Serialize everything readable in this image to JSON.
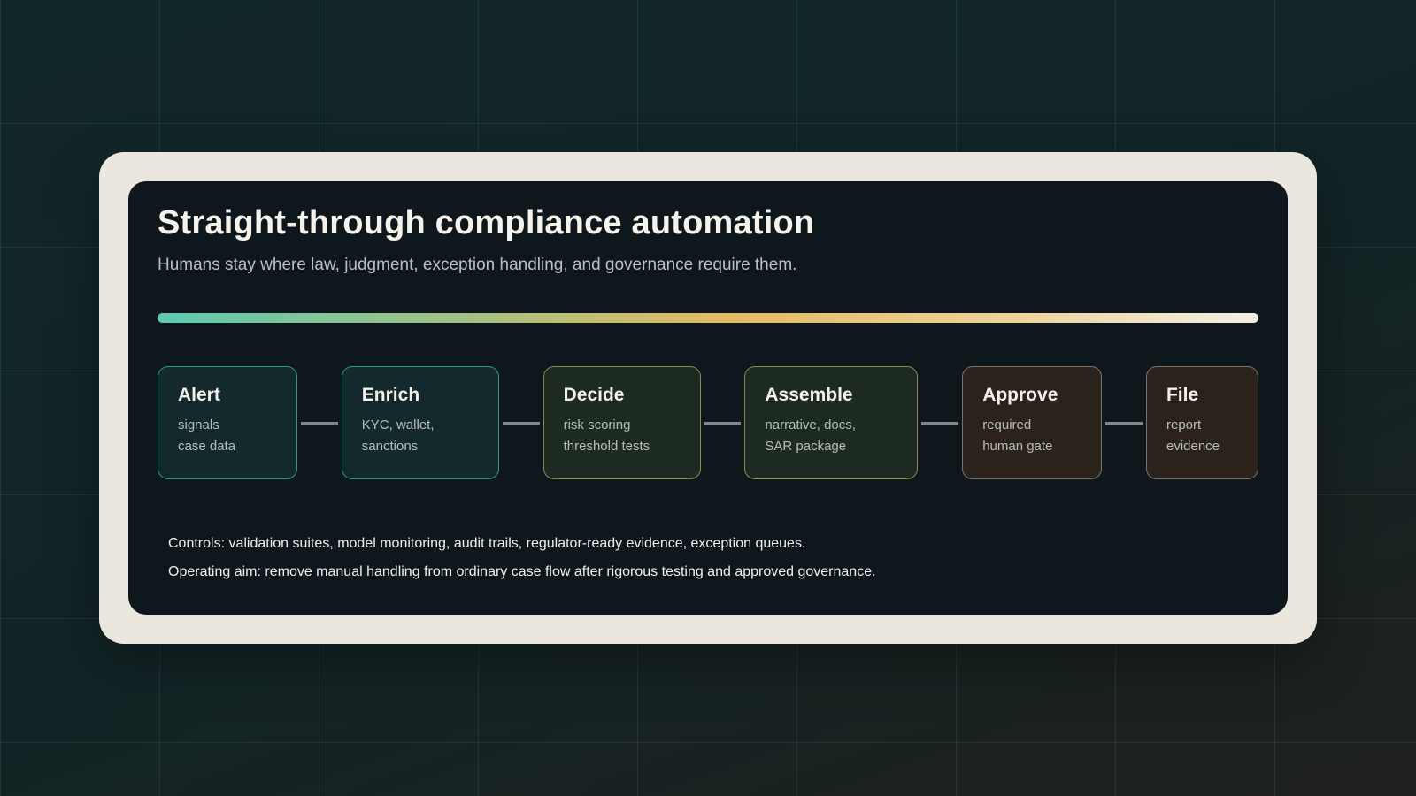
{
  "title": "Straight-through compliance automation",
  "subtitle": "Humans stay where law, judgment, exception handling, and governance require them.",
  "colors": {
    "gradient_start": "#5ec9b0",
    "gradient_mid": "#e6b964",
    "gradient_end": "#f3efe6",
    "panel_background": "#0e171c",
    "frame_background": "#ece7de"
  },
  "steps": [
    {
      "title": "Alert",
      "lines": [
        "signals",
        "case data"
      ],
      "tone": "teal"
    },
    {
      "title": "Enrich",
      "lines": [
        "KYC, wallet,",
        "sanctions"
      ],
      "tone": "teal"
    },
    {
      "title": "Decide",
      "lines": [
        "risk scoring",
        "threshold tests"
      ],
      "tone": "olive"
    },
    {
      "title": "Assemble",
      "lines": [
        "narrative, docs,",
        "SAR package"
      ],
      "tone": "olive"
    },
    {
      "title": "Approve",
      "lines": [
        "required",
        "human gate"
      ],
      "tone": "brown"
    },
    {
      "title": "File",
      "lines": [
        "report",
        "evidence"
      ],
      "tone": "brown"
    }
  ],
  "footer": {
    "controls": "Controls: validation suites, model monitoring, audit trails, regulator-ready evidence, exception queues.",
    "aim": "Operating aim: remove manual handling from ordinary case flow after rigorous testing and approved governance."
  }
}
